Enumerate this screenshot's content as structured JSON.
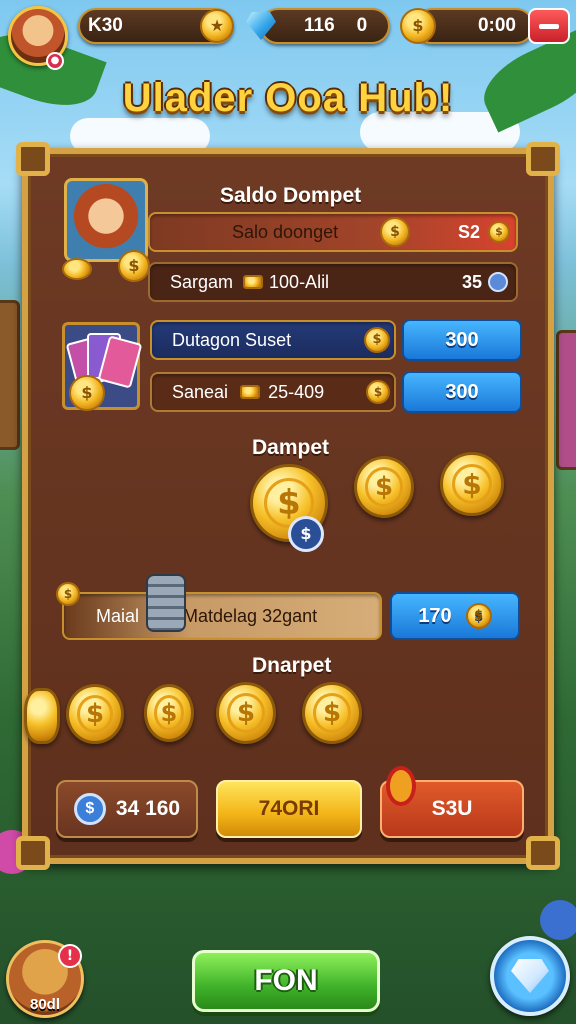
{
  "header": {
    "currency1_value": "K30",
    "currency2_value": "116",
    "currency2_extra": "0",
    "timer_value": "0:00",
    "title": "Ulader Ooa Hub!"
  },
  "panel": {
    "section1_title": "Saldo Dompet",
    "row1": {
      "label": "Salo doonget",
      "value": "S2"
    },
    "row2": {
      "label": "Sargam",
      "detail": "100-Alil",
      "value": "35"
    },
    "row3": {
      "label": "Dutagon Suset",
      "button": "300"
    },
    "row4": {
      "label": "Saneai",
      "detail": "25-409",
      "button": "300"
    },
    "section2_title": "Dampet",
    "row5": {
      "label_left": "Maial",
      "label_right": "Matdelag 32gant",
      "button": "170"
    },
    "section3_title": "Dnarpet",
    "buttons": [
      {
        "label": "34 160"
      },
      {
        "label": "74ORI"
      },
      {
        "label": "S3U"
      }
    ]
  },
  "footer": {
    "chest_label": "80dl",
    "chest_badge": "!",
    "main_button": "FON"
  },
  "colors": {
    "gold": "#f5c542",
    "panel_brown": "#5e301d",
    "blue_button": "#1a78d8",
    "green_button": "#3fb22a",
    "red_button": "#c9202a"
  }
}
